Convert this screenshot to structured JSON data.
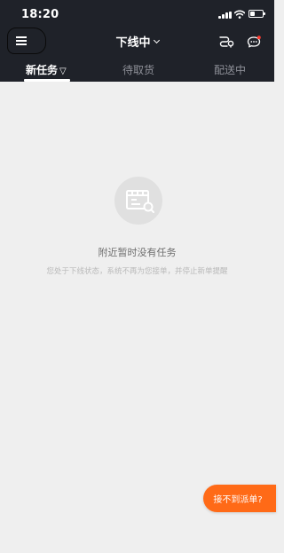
{
  "status_bar": {
    "time": "18:20",
    "battery_level": 0.4
  },
  "header": {
    "title": "下线中"
  },
  "tabs": [
    {
      "label": "新任务",
      "active": true,
      "filter_icon": "▽"
    },
    {
      "label": "待取货",
      "active": false
    },
    {
      "label": "配送中",
      "active": false
    }
  ],
  "empty_state": {
    "title": "附近暂时没有任务",
    "subtitle": "您处于下线状态，系统不再为您接单，并停止新单提醒"
  },
  "float_button": {
    "label": "接不到派单?"
  },
  "colors": {
    "header_bg": "#1f2229",
    "page_bg": "#efefef",
    "accent": "#ff6a17",
    "badge": "#ff3b30"
  }
}
